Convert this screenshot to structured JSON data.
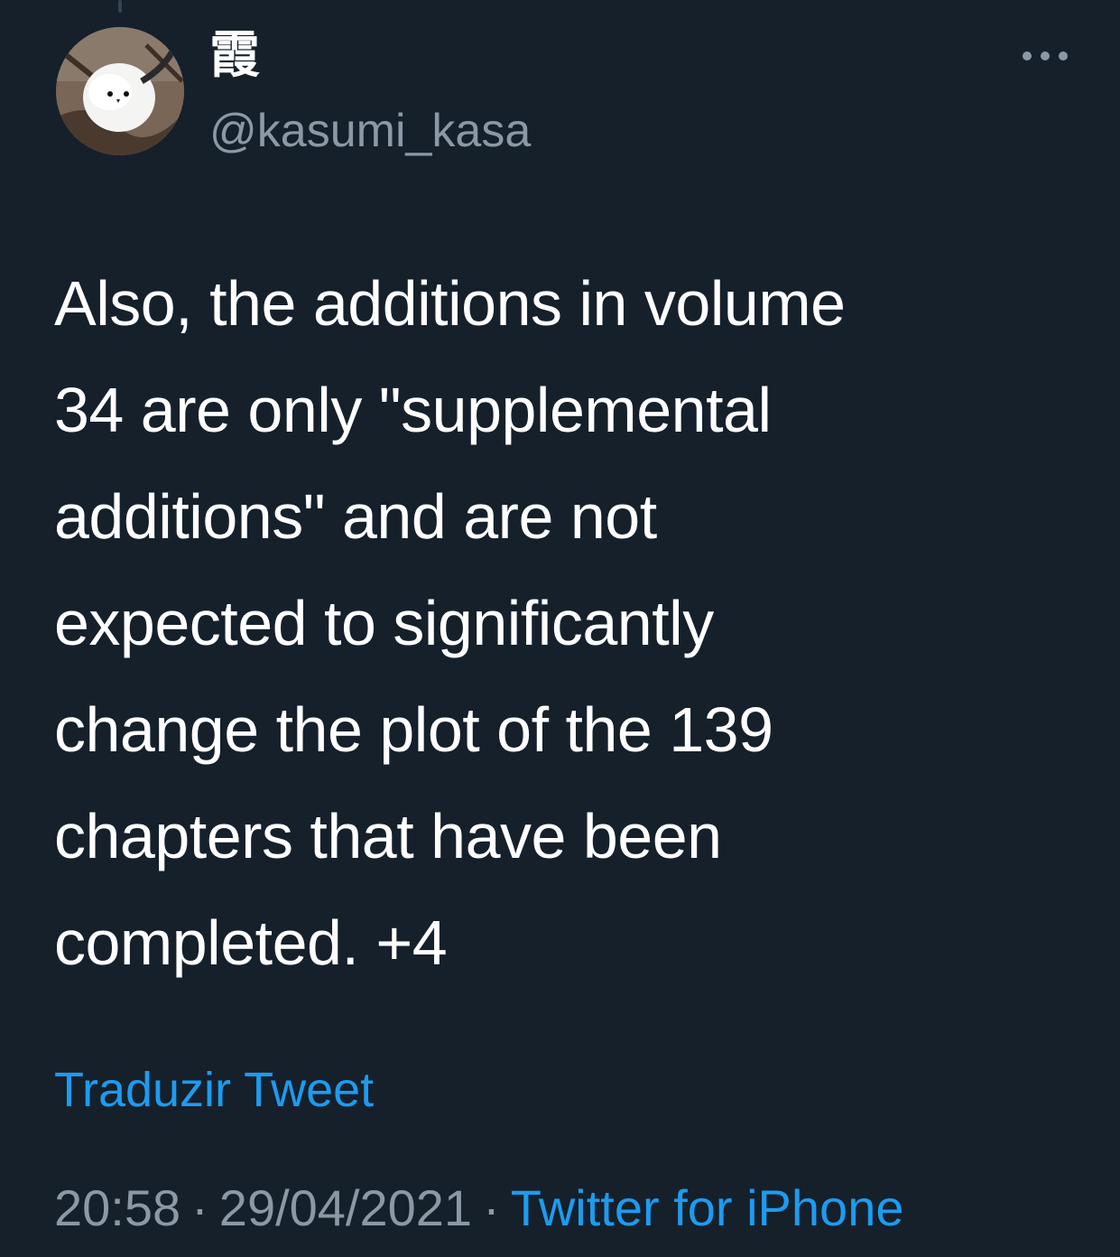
{
  "author": {
    "display_name": "霞",
    "handle": "@kasumi_kasa",
    "avatar_icon": "bird-avatar"
  },
  "actions": {
    "more_icon": "more-horizontal-icon"
  },
  "tweet": {
    "text": "Also, the additions in volume\n34 are only \"supplemental\nadditions\" and are not\nexpected to significantly\nchange the plot of the 139\nchapters that have been\ncompleted. +4",
    "translate_label": "Traduzir Tweet",
    "time": "20:58",
    "date": "29/04/2021",
    "source": "Twitter for iPhone",
    "separator": "·"
  },
  "colors": {
    "background": "#15202b",
    "text": "#ffffff",
    "secondary_text": "#8b98a5",
    "link": "#1d9bf0"
  }
}
